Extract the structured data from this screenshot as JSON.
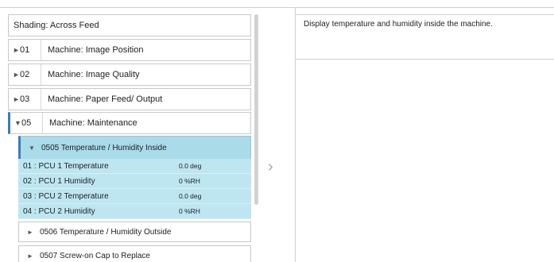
{
  "title": "Shading: Across Feed",
  "menu": [
    {
      "arrow": "►",
      "num": "01",
      "label": "Machine: Image Position"
    },
    {
      "arrow": "►",
      "num": "02",
      "label": "Machine: Image Quality"
    },
    {
      "arrow": "►",
      "num": "03",
      "label": "Machine: Paper Feed/ Output"
    },
    {
      "arrow": "▼",
      "num": "05",
      "label": "Machine: Maintenance"
    }
  ],
  "submenu_open": {
    "arrow": "▼",
    "label": "0505 Temperature / Humidity Inside"
  },
  "readings": [
    {
      "key": "01 : PCU 1 Temperature",
      "value": "0.0 deg"
    },
    {
      "key": "02 : PCU 1 Humidity",
      "value": "0 %RH"
    },
    {
      "key": "03 : PCU 2 Temperature",
      "value": "0.0 deg"
    },
    {
      "key": "04 : PCU 2 Humidity",
      "value": "0 %RH"
    }
  ],
  "submenu_closed": [
    {
      "arrow": "►",
      "label": "0506 Temperature / Humidity Outside"
    },
    {
      "arrow": "►",
      "label": "0507 Screw-on Cap to Replace"
    }
  ],
  "nav_arrow": "›",
  "description": "Display temperature and humidity inside the machine."
}
